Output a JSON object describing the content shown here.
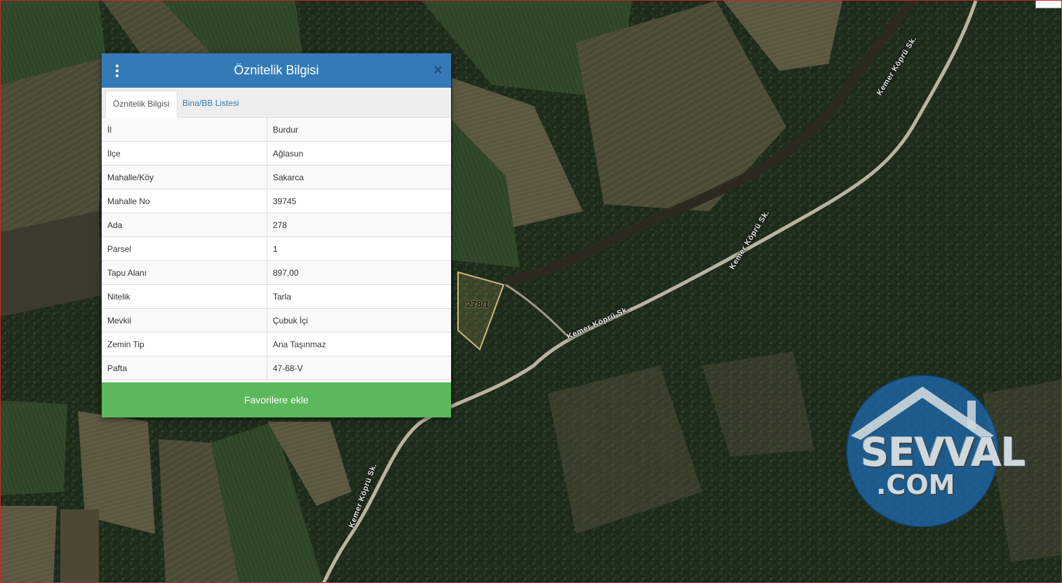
{
  "map": {
    "road_label": "Kemer Köprü Sk.",
    "parcel_label": "278/1"
  },
  "watermark": {
    "line1": "SEVVAL",
    "line2": ".COM"
  },
  "dialog": {
    "title": "Öznitelik Bilgisi",
    "close_label": "×",
    "tabs": [
      {
        "label": "Öznitelik Bilgisi",
        "active": true
      },
      {
        "label": "Bina/BB Listesi",
        "active": false
      }
    ],
    "rows": [
      {
        "key": "İl",
        "value": "Burdur"
      },
      {
        "key": "İlçe",
        "value": "Ağlasun"
      },
      {
        "key": "Mahalle/Köy",
        "value": "Sakarca"
      },
      {
        "key": "Mahalle No",
        "value": "39745"
      },
      {
        "key": "Ada",
        "value": "278"
      },
      {
        "key": "Parsel",
        "value": "1"
      },
      {
        "key": "Tapu Alanı",
        "value": "897,00"
      },
      {
        "key": "Nitelik",
        "value": "Tarla"
      },
      {
        "key": "Mevkii",
        "value": "Çubuk İçi"
      },
      {
        "key": "Zemin Tip",
        "value": "Ana Taşınmaz"
      },
      {
        "key": "Pafta",
        "value": "47-68-V"
      }
    ],
    "favorite_button": "Favorilere ekle"
  },
  "colors": {
    "header": "#337ab7",
    "button": "#5cb85c",
    "parcel_outline": "#c9b877"
  }
}
